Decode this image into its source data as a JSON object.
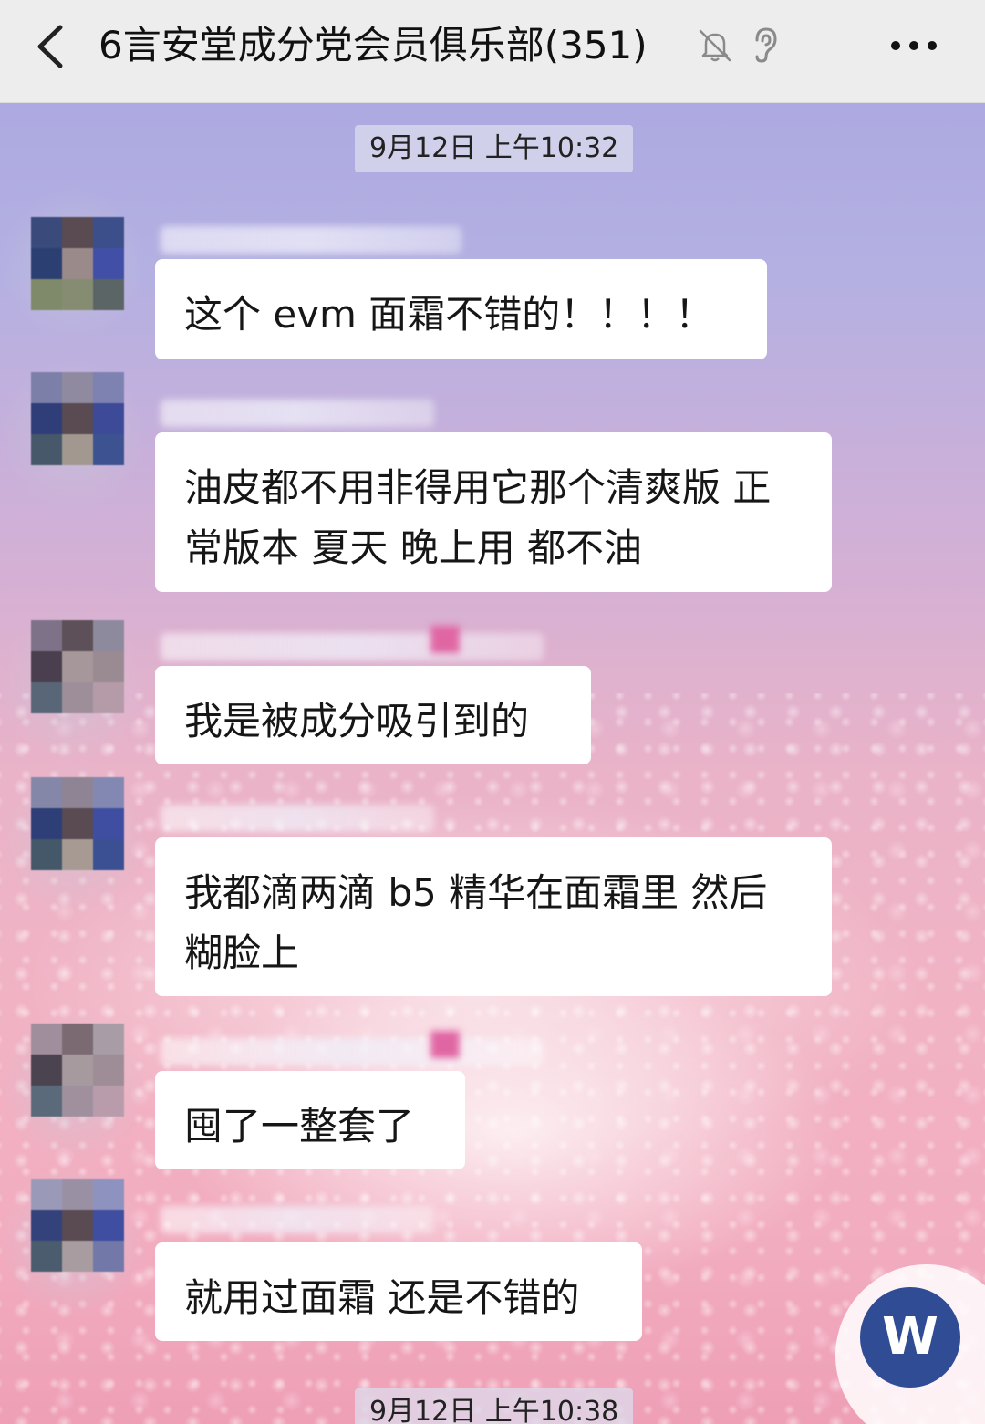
{
  "header": {
    "title": "6言安堂成分党会员俱乐部(351)",
    "icons": [
      "back-icon",
      "mute-icon",
      "voice-ear-icon",
      "more-icon"
    ]
  },
  "timestamps": [
    "9月12日 上午10:32",
    "9月12日 上午10:38"
  ],
  "messages": [
    {
      "text": "这个 evm 面霜不错的！！！！"
    },
    {
      "text": "油皮都不用非得用它那个清爽版 正\n常版本 夏天 晚上用 都不油"
    },
    {
      "text": "我是被成分吸引到的"
    },
    {
      "text": "我都滴两滴 b5 精华在面霜里 然后\n糊脸上"
    },
    {
      "text": "囤了一整套了"
    },
    {
      "text": "就用过面霜 还是不错的"
    }
  ],
  "fab": {
    "label": "W"
  },
  "colors": {
    "header_bg": "#ededed",
    "bubble_bg": "#ffffff",
    "fab_bg": "#2f4c94",
    "ribbon": "#e066a3"
  }
}
